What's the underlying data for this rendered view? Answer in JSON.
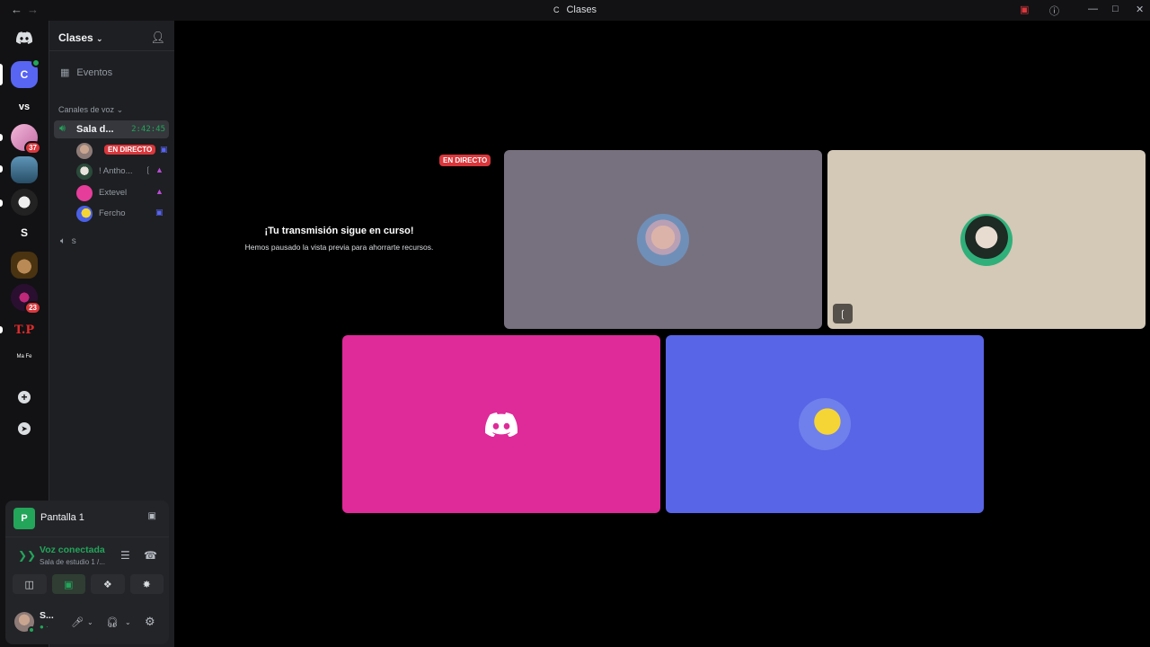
{
  "window": {
    "title": "Clases",
    "title_mark": "C",
    "back_icon": "arrow-left-icon",
    "forward_icon": "arrow-right-icon"
  },
  "guilds": [
    {
      "label": "",
      "icon": "discord-home-icon",
      "color": "#121214"
    },
    {
      "label": "C",
      "color": "#5865f2"
    },
    {
      "label": "vs",
      "color": "#121214"
    },
    {
      "label": "",
      "badge": "37",
      "color": "#e8a0c8"
    },
    {
      "label": "",
      "color": "#3d6d8d"
    },
    {
      "label": "",
      "color": "#202020"
    },
    {
      "label": "S",
      "color": "#121214"
    },
    {
      "label": "",
      "color": "#8a6d1e"
    },
    {
      "label": "",
      "badge": "23",
      "color": "#3b1a3f"
    },
    {
      "label": "T.P",
      "color": "#121214"
    },
    {
      "label": "Ma Fe",
      "color": "#121214"
    },
    {
      "label": "+",
      "icon": "add-server-icon",
      "color": "#121214"
    },
    {
      "label": "",
      "icon": "compass-icon",
      "color": "#121214"
    }
  ],
  "sidebar": {
    "server_name": "Clases",
    "events_label": "Eventos",
    "category_label": "Canales de voz",
    "active_channel": {
      "name": "Sala d...",
      "time": "2:42:45"
    },
    "members": [
      {
        "name": "",
        "live_label": "EN DIRECTO",
        "avatar_color": "#8d7b78"
      },
      {
        "name": "! Antho...",
        "avatar_color": "#3a7a5c"
      },
      {
        "name": "Extevel",
        "avatar_color": "#e63d9b"
      },
      {
        "name": "Fercho",
        "avatar_color": "#4a60e6"
      }
    ],
    "second_channel": "s"
  },
  "panel": {
    "share_label": "Pantalla 1",
    "share_initial": "P",
    "voice_status": "Voz conectada",
    "voice_channel": "Sala de estudio 1 /...",
    "user_name": "S...",
    "user_status": "● ·"
  },
  "stage": {
    "live_tag": "EN DIRECTO",
    "paused_title": "¡Tu transmisión sigue en curso!",
    "paused_subtitle": "Hemos pausado la vista previa para ahorrarte recursos.",
    "tiles": [
      {
        "bg": "#77717f",
        "kind": "avatar-masked"
      },
      {
        "bg": "#d4c8b7",
        "kind": "avatar-green",
        "muted": true
      },
      {
        "bg": "#df2a99",
        "kind": "discord-logo"
      },
      {
        "bg": "#5865e6",
        "kind": "avatar-duck"
      }
    ]
  }
}
